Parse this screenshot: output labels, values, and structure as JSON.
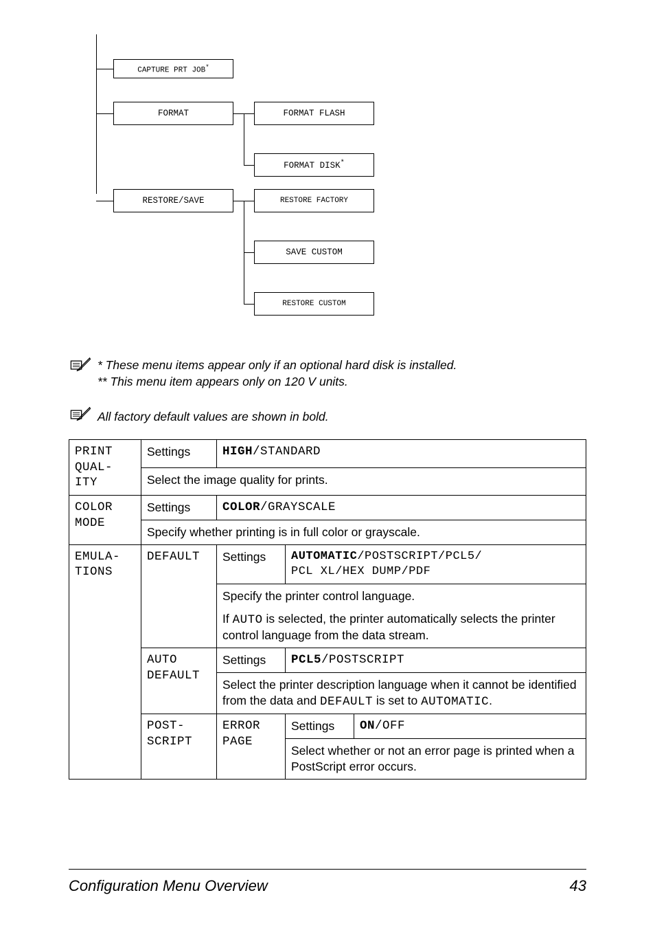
{
  "diagram": {
    "capture": "CAPTURE PRT JOB",
    "format": "FORMAT",
    "format_flash": "FORMAT FLASH",
    "format_disk": "FORMAT DISK",
    "restore_save": "RESTORE/SAVE",
    "restore_factory": "RESTORE FACTORY",
    "save_custom": "SAVE CUSTOM",
    "restore_custom": "RESTORE CUSTOM",
    "asterisk": "*"
  },
  "notes": {
    "n1_line1": "* These menu items appear only if an optional hard disk is installed.",
    "n1_line2": "** This menu item appears only on 120 V units.",
    "n2": "All factory default values are shown in bold."
  },
  "table": {
    "settings_label": "Settings",
    "print_quality": {
      "key": "PRINT QUAL-ITY",
      "values": {
        "high": "HIGH",
        "sep": "/",
        "std": "STANDARD"
      },
      "desc": "Select the image quality for prints."
    },
    "color_mode": {
      "key": "COLOR MODE",
      "values": {
        "color": "COLOR",
        "sep": "/",
        "gray": "GRAYSCALE"
      },
      "desc": "Specify whether printing is in full color or grayscale."
    },
    "emulations": {
      "key": "EMULA-TIONS",
      "default_label": "DEFAULT",
      "default_vals": "AUTOMATIC/POSTSCRIPT/PCL5/\nPCL XL/HEX DUMP/PDF",
      "default_vals_auto": "AUTOMATIC",
      "default_vals_rest": "/POSTSCRIPT/PCL5/",
      "default_vals_line2": "PCL XL/HEX DUMP/PDF",
      "default_desc1": "Specify the printer control language.",
      "default_desc2a": "If ",
      "default_desc2_mono": "AUTO",
      "default_desc2b": " is selected, the printer automatically selects the printer control language from the data stream.",
      "auto_default_label": "AUTO DEFAULT",
      "auto_vals_pcl5": "PCL5",
      "auto_vals_rest": "/POSTSCRIPT",
      "auto_desc1": "Select the printer description language when it cannot be identified from the data and ",
      "auto_desc_mono": "DEFAULT",
      "auto_desc2": " is set to ",
      "auto_desc_mono2": "AUTOMATIC",
      "auto_desc3": ".",
      "postscript_label": "POST-SCRIPT",
      "error_page_label": "ERROR PAGE",
      "ps_vals_on": "ON",
      "ps_vals_rest": "/OFF",
      "ps_desc": "Select whether or not an error page is printed when a PostScript error occurs."
    }
  },
  "footer": {
    "title": "Configuration Menu Overview",
    "page": "43"
  }
}
